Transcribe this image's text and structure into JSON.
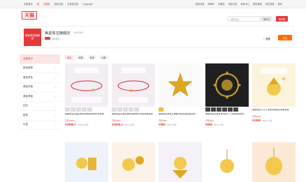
{
  "topbar": {
    "left": [
      "天猫首页",
      "喵",
      "请登录",
      "免费注册",
      "手机逛天猫",
      "Language"
    ],
    "right": [
      "我的淘宝",
      "购物车",
      "收藏夹",
      "商品分类",
      "卖家中心",
      "联系客服",
      "网站导航",
      "更多"
    ]
  },
  "header": {
    "logo": "天猫",
    "search_placeholder": "搜索宝贝",
    "search_button": "搜本店",
    "search_button2": "搜天猫"
  },
  "shop": {
    "logo_text": "美星珠宝旗舰店",
    "name": "美星珠宝旗舰店",
    "sub": "MEIXING",
    "tag_note": "5年老店",
    "fav_label": "收藏",
    "follow_label": "关注"
  },
  "sidebar": {
    "items": [
      {
        "label": "全部宝贝",
        "active": true
      },
      {
        "label": "新品推荐",
        "active": false
      },
      {
        "label": "黄金吊坠",
        "active": false
      },
      {
        "label": "黄金手链",
        "active": false
      },
      {
        "label": "黄金项链",
        "active": false
      },
      {
        "label": "钻石",
        "active": false
      },
      {
        "label": "银饰",
        "active": false
      },
      {
        "label": "礼盒",
        "active": false
      }
    ]
  },
  "filters": [
    "综合",
    "销量",
    "新品",
    "价格"
  ],
  "products": [
    {
      "title": "美星珠宝足金红绳手链情侣本命年转运珠",
      "sub": "已售1000+",
      "price": "¥2899.2",
      "sold": "1000人付款"
    },
    {
      "title": "美星珠宝足金红绳手链本命年转运珠情侣款",
      "sub": "已售800+",
      "price": "¥2699.2",
      "sold": "800人付款"
    },
    {
      "title": "美星珠宝黄金五角星吊坠足金挂坠女款",
      "sub": "已售500+",
      "price": "¥980",
      "sold": "500人付款"
    },
    {
      "title": "美星珠宝足金生肖吊坠十二生肖转运挂件",
      "sub": "已售300+",
      "price": "¥998",
      "sold": "300人付款"
    },
    {
      "title": "美星珠宝小王子足金吊坠星空黄金项链",
      "sub": "已售200+",
      "price": "¥1680",
      "sold": "200人付款"
    }
  ]
}
